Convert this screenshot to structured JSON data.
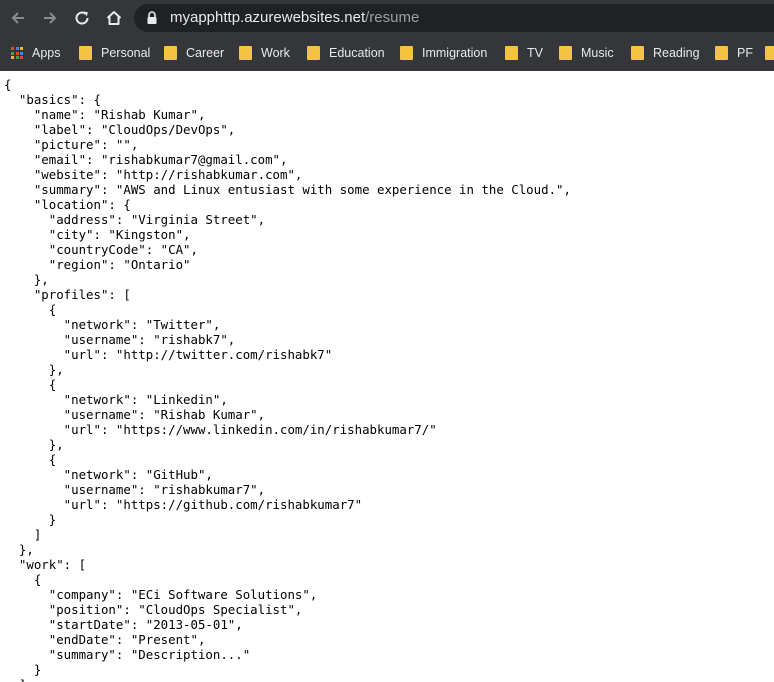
{
  "browser": {
    "url_host": "myapphttp.azurewebsites.net",
    "url_path": "/resume",
    "bookmarks": [
      {
        "label": "Apps",
        "icon": "apps-grid-icon"
      },
      {
        "label": "Personal",
        "icon": "folder-icon"
      },
      {
        "label": "Career",
        "icon": "folder-icon"
      },
      {
        "label": "Work",
        "icon": "folder-icon"
      },
      {
        "label": "Education",
        "icon": "folder-icon"
      },
      {
        "label": "Immigration",
        "icon": "folder-icon"
      },
      {
        "label": "TV",
        "icon": "folder-icon"
      },
      {
        "label": "Music",
        "icon": "folder-icon"
      },
      {
        "label": "Reading",
        "icon": "folder-icon"
      },
      {
        "label": "PF",
        "icon": "folder-icon"
      }
    ],
    "colors": {
      "toolbar_bg": "#35363a",
      "omnibox_bg": "#202124",
      "folder": "#f4c341"
    }
  },
  "page": {
    "json_text": "{\n  \"basics\": {\n    \"name\": \"Rishab Kumar\",\n    \"label\": \"CloudOps/DevOps\",\n    \"picture\": \"\",\n    \"email\": \"rishabkumar7@gmail.com\",\n    \"website\": \"http://rishabkumar.com\",\n    \"summary\": \"AWS and Linux entusiast with some experience in the Cloud.\",\n    \"location\": {\n      \"address\": \"Virginia Street\",\n      \"city\": \"Kingston\",\n      \"countryCode\": \"CA\",\n      \"region\": \"Ontario\"\n    },\n    \"profiles\": [\n      {\n        \"network\": \"Twitter\",\n        \"username\": \"rishabk7\",\n        \"url\": \"http://twitter.com/rishabk7\"\n      },\n      {\n        \"network\": \"Linkedin\",\n        \"username\": \"Rishab Kumar\",\n        \"url\": \"https://www.linkedin.com/in/rishabkumar7/\"\n      },\n      {\n        \"network\": \"GitHub\",\n        \"username\": \"rishabkumar7\",\n        \"url\": \"https://github.com/rishabkumar7\"\n      }\n    ]\n  },\n  \"work\": [\n    {\n      \"company\": \"ECi Software Solutions\",\n      \"position\": \"CloudOps Specialist\",\n      \"startDate\": \"2013-05-01\",\n      \"endDate\": \"Present\",\n      \"summary\": \"Description...\"\n    }\n  ]"
  }
}
